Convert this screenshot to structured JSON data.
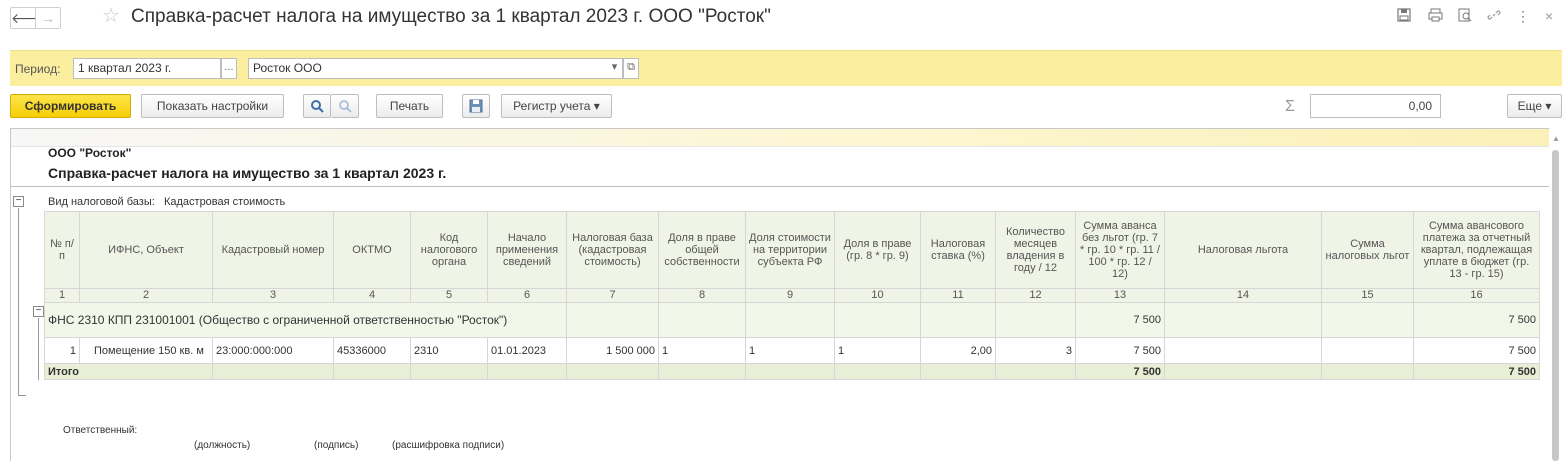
{
  "window": {
    "title": "Справка-расчет налога на имущество за 1 квартал 2023 г. ООО \"Росток\"",
    "back_glyph": "🡐",
    "fwd_glyph": "→",
    "star_glyph": "☆",
    "icons": [
      "save-icon",
      "print-icon",
      "preview-icon",
      "link-icon",
      "more-icon",
      "close-icon"
    ]
  },
  "filter": {
    "period_label": "Период:",
    "period_value": "1 квартал 2023 г.",
    "period_btn": "...",
    "org_value": "Росток ООО",
    "org_dropdown": "▾",
    "org_open": "⧉"
  },
  "toolbar": {
    "generate_label": "Сформировать",
    "settings_label": "Показать настройки",
    "print_label": "Печать",
    "register_label": "Регистр учета ▾",
    "sum_sign": "Σ",
    "sum_value": "0,00",
    "more_label": "Еще ▾"
  },
  "report": {
    "org": "ООО \"Росток\"",
    "title": "Справка-расчет налога на имущество за 1 квартал 2023 г.",
    "base_label": "Вид налоговой базы:",
    "base_value": "Кадастровая стоимость",
    "columns": [
      "№ п/п",
      "ИФНС, Объект",
      "Кадастровый номер",
      "ОКТМО",
      "Код налогового органа",
      "Начало применения сведений",
      "Налоговая база (кадастровая стоимость)",
      "Доля в праве общей собственности",
      "Доля стоимости на территории субъекта РФ",
      "Доля в праве (гр. 8 * гр. 9)",
      "Налоговая ставка (%)",
      "Количество месяцев владения в году / 12",
      "Сумма аванса без льгот (гр. 7 * гр. 10 * гр. 11 / 100 * гр. 12 / 12)",
      "Налоговая льгота",
      "Сумма налоговых льгот",
      "Сумма авансового платежа за отчетный квартал, подлежащая уплате в бюджет (гр. 13 - гр. 15)"
    ],
    "column_numbers": [
      "1",
      "2",
      "3",
      "4",
      "5",
      "6",
      "7",
      "8",
      "9",
      "10",
      "11",
      "12",
      "13",
      "14",
      "15",
      "16"
    ],
    "group": {
      "label": "ФНС 2310 КПП 231001001 (Общество с ограниченной ответственностью \"Росток\")",
      "col13": "7 500",
      "col16": "7 500"
    },
    "row": {
      "num": "1",
      "object": "Помещение 150 кв. м",
      "cadastral": "23:000:000:000",
      "oktmo": "45336000",
      "tax_code": "2310",
      "start_date": "01.01.2023",
      "base": "1 500 000",
      "share": "1",
      "share_region": "1",
      "share_total": "1",
      "rate": "2,00",
      "months": "3",
      "advance": "7 500",
      "benefit": "",
      "benefit_sum": "",
      "payable": "7 500"
    },
    "total": {
      "label": "Итого",
      "col13": "7 500",
      "col16": "7 500"
    },
    "signature": {
      "responsible": "Ответственный:",
      "position": "(должность)",
      "sign": "(подпись)",
      "decode": "(расшифровка подписи)"
    }
  }
}
